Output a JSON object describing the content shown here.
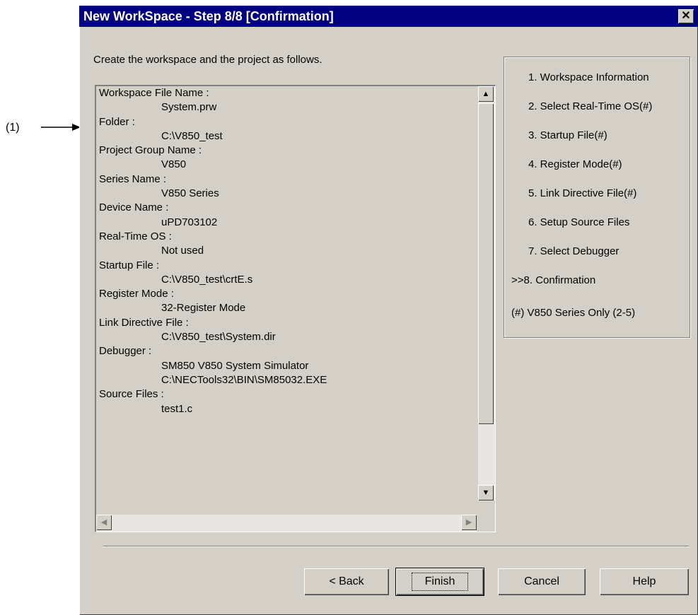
{
  "callout": {
    "label": "(1)"
  },
  "dialog": {
    "title": "New WorkSpace - Step 8/8 [Confirmation]",
    "close_glyph": "✕",
    "intro": "Create the workspace and the project as follows."
  },
  "summary": {
    "rows": [
      {
        "text": "Workspace File Name :",
        "kind": "label"
      },
      {
        "text": "System.prw",
        "kind": "value"
      },
      {
        "text": "Folder :",
        "kind": "label"
      },
      {
        "text": "C:\\V850_test",
        "kind": "value"
      },
      {
        "text": "Project Group Name :",
        "kind": "label"
      },
      {
        "text": "V850",
        "kind": "value"
      },
      {
        "text": "Series Name :",
        "kind": "label"
      },
      {
        "text": "V850 Series",
        "kind": "value"
      },
      {
        "text": "Device Name :",
        "kind": "label"
      },
      {
        "text": "uPD703102",
        "kind": "value"
      },
      {
        "text": "Real-Time OS :",
        "kind": "label"
      },
      {
        "text": "Not used",
        "kind": "value"
      },
      {
        "text": "Startup File :",
        "kind": "label"
      },
      {
        "text": "C:\\V850_test\\crtE.s",
        "kind": "value"
      },
      {
        "text": "Register Mode :",
        "kind": "label"
      },
      {
        "text": "32-Register Mode",
        "kind": "value"
      },
      {
        "text": "Link Directive File :",
        "kind": "label"
      },
      {
        "text": "C:\\V850_test\\System.dir",
        "kind": "value"
      },
      {
        "text": "Debugger :",
        "kind": "label"
      },
      {
        "text": "SM850 V850 System Simulator",
        "kind": "value"
      },
      {
        "text": "C:\\NECTools32\\BIN\\SM85032.EXE",
        "kind": "value"
      },
      {
        "text": "Source Files :",
        "kind": "label"
      },
      {
        "text": "test1.c",
        "kind": "value"
      }
    ]
  },
  "steps": {
    "items": [
      "1. Workspace Information",
      "2. Select Real-Time OS(#)",
      "3. Startup File(#)",
      "4. Register Mode(#)",
      "5. Link Directive File(#)",
      "6. Setup Source Files",
      "7. Select Debugger",
      ">>8. Confirmation",
      "(#) V850 Series Only (2-5)"
    ]
  },
  "buttons": {
    "back": "< Back",
    "finish": "Finish",
    "cancel": "Cancel",
    "help": "Help"
  }
}
